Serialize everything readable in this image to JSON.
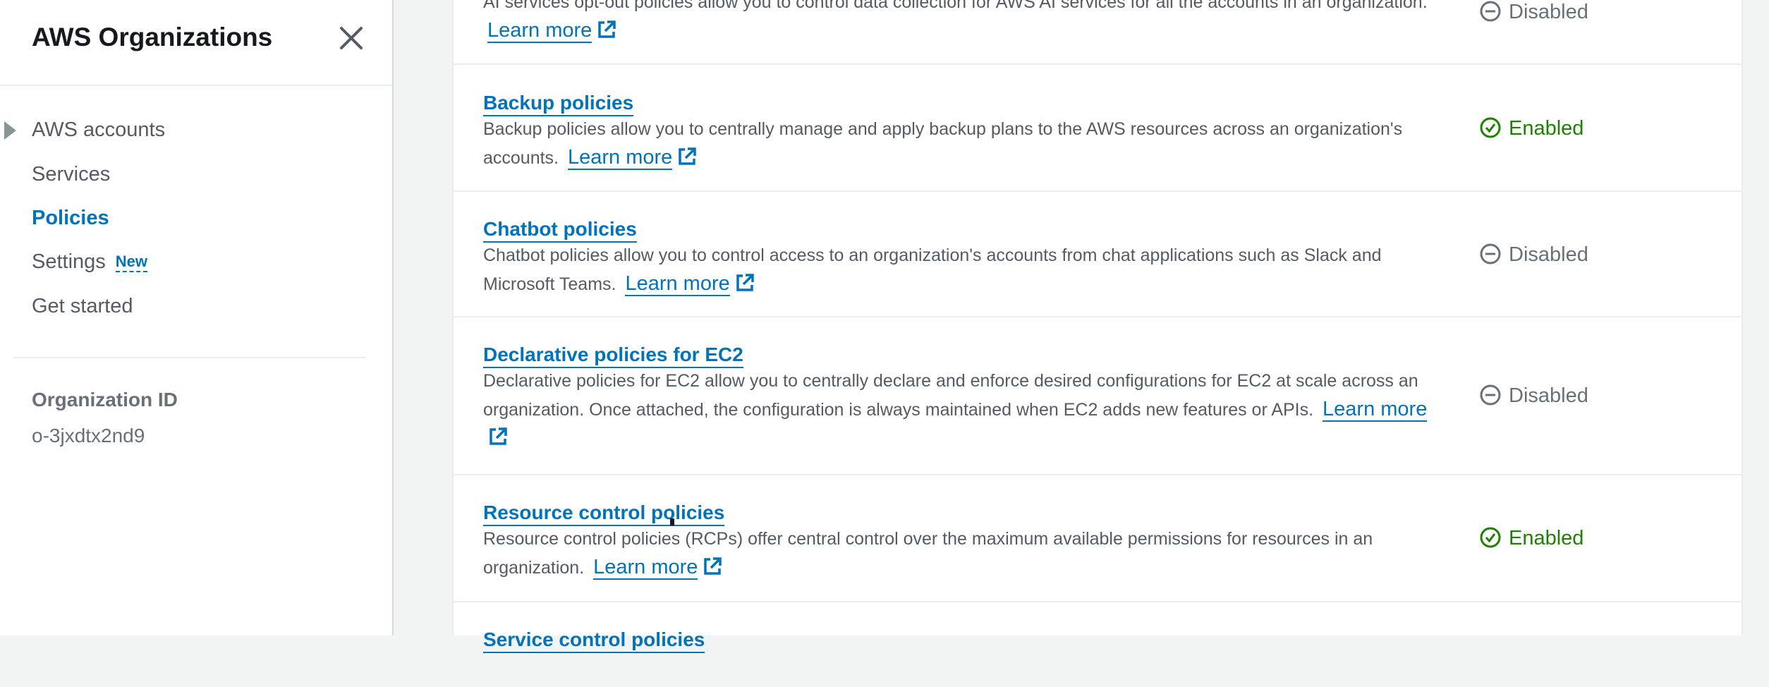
{
  "sidebar": {
    "title": "AWS Organizations",
    "items": [
      {
        "label": "AWS accounts"
      },
      {
        "label": "Services"
      },
      {
        "label": "Policies"
      },
      {
        "label": "Settings",
        "badge": "New"
      },
      {
        "label": "Get started"
      }
    ],
    "org_id_label": "Organization ID",
    "org_id_value": "o-3jxdtx2nd9"
  },
  "policies": [
    {
      "name": "",
      "description": "AI services opt-out policies allow you to control data collection for AWS AI services for all the accounts in an organization.",
      "learn_more": "Learn more",
      "status": "Disabled"
    },
    {
      "name": "Backup policies",
      "description": "Backup policies allow you to centrally manage and apply backup plans to the AWS resources across an organization's accounts.",
      "learn_more": "Learn more",
      "status": "Enabled"
    },
    {
      "name": "Chatbot policies",
      "description": "Chatbot policies allow you to control access to an organization's accounts from chat applications such as Slack and Microsoft Teams.",
      "learn_more": "Learn more",
      "status": "Disabled"
    },
    {
      "name": "Declarative policies for EC2",
      "description": "Declarative policies for EC2 allow you to centrally declare and enforce desired configurations for EC2 at scale across an organization. Once attached, the configuration is always maintained when EC2 adds new features or APIs.",
      "learn_more": "Learn more",
      "status": "Disabled"
    },
    {
      "name": "Resource control policies",
      "description": "Resource control policies (RCPs) offer central control over the maximum available permissions for resources in an organization.",
      "learn_more": "Learn more",
      "status": "Enabled"
    },
    {
      "name": "Service control policies"
    }
  ],
  "colors": {
    "link": "#0073bb",
    "enabled": "#1d8102",
    "disabled": "#687078"
  }
}
